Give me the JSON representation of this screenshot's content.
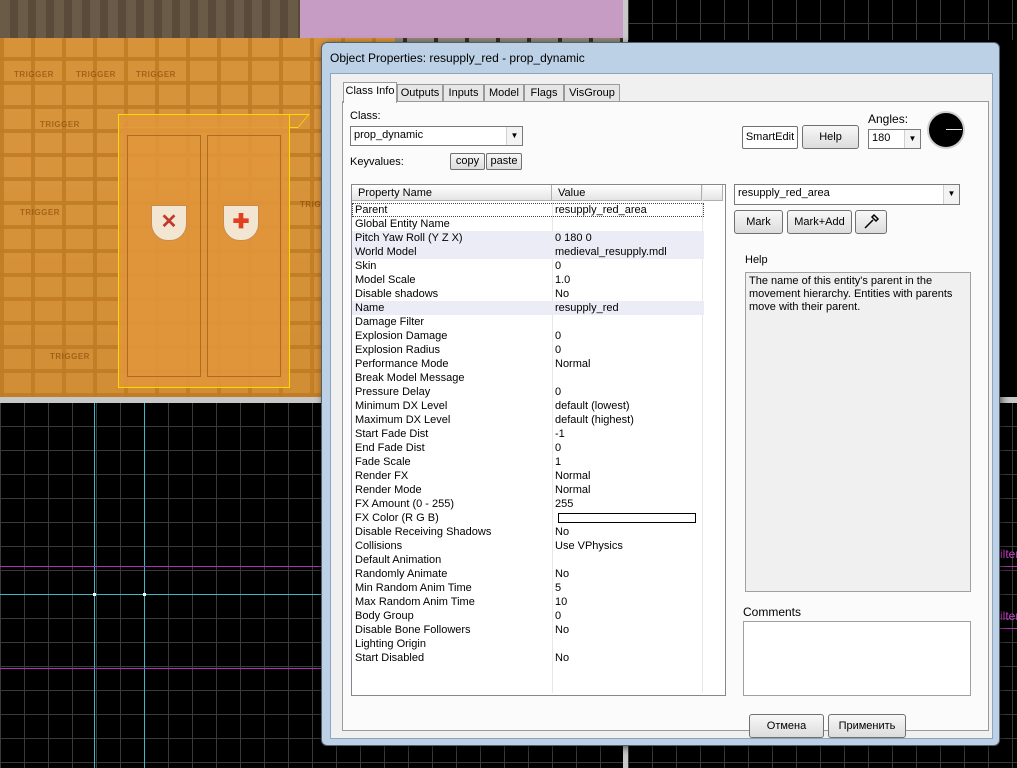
{
  "viewport": {
    "trigger_text": "TRIGGER",
    "overlay_label": "ilter"
  },
  "dialog": {
    "title": "Object Properties: resupply_red - prop_dynamic",
    "tabs": [
      {
        "label": "Class Info",
        "active": true
      },
      {
        "label": "Outputs"
      },
      {
        "label": "Inputs"
      },
      {
        "label": "Model"
      },
      {
        "label": "Flags"
      },
      {
        "label": "VisGroup"
      }
    ],
    "class_label": "Class:",
    "class_value": "prop_dynamic",
    "keyvalues_label": "Keyvalues:",
    "copy_label": "copy",
    "paste_label": "paste",
    "smartedit_label": "SmartEdit",
    "help_button_label": "Help",
    "angles_label": "Angles:",
    "angles_value": "180",
    "grid": {
      "col_property": "Property Name",
      "col_value": "Value",
      "rows": [
        {
          "name": "Parent",
          "value": "resupply_red_area"
        },
        {
          "name": "Global Entity Name",
          "value": ""
        },
        {
          "name": "Pitch Yaw Roll (Y Z X)",
          "value": "0 180 0"
        },
        {
          "name": "World Model",
          "value": "medieval_resupply.mdl"
        },
        {
          "name": "Skin",
          "value": "0"
        },
        {
          "name": "Model Scale",
          "value": "1.0"
        },
        {
          "name": "Disable shadows",
          "value": "No"
        },
        {
          "name": "Name",
          "value": "resupply_red"
        },
        {
          "name": "Damage Filter",
          "value": ""
        },
        {
          "name": "Explosion Damage",
          "value": "0"
        },
        {
          "name": "Explosion Radius",
          "value": "0"
        },
        {
          "name": "Performance Mode",
          "value": "Normal"
        },
        {
          "name": "Break Model Message",
          "value": ""
        },
        {
          "name": "Pressure Delay",
          "value": "0"
        },
        {
          "name": "Minimum DX Level",
          "value": "default (lowest)"
        },
        {
          "name": "Maximum DX Level",
          "value": "default (highest)"
        },
        {
          "name": "Start Fade Dist",
          "value": "-1"
        },
        {
          "name": "End Fade Dist",
          "value": "0"
        },
        {
          "name": "Fade Scale",
          "value": "1"
        },
        {
          "name": "Render FX",
          "value": "Normal"
        },
        {
          "name": "Render Mode",
          "value": "Normal"
        },
        {
          "name": "FX Amount (0 - 255)",
          "value": "255"
        },
        {
          "name": "FX Color (R G B)",
          "value": ""
        },
        {
          "name": "Disable Receiving Shadows",
          "value": "No"
        },
        {
          "name": "Collisions",
          "value": "Use VPhysics"
        },
        {
          "name": "Default Animation",
          "value": ""
        },
        {
          "name": "Randomly Animate",
          "value": "No"
        },
        {
          "name": "Min Random Anim Time",
          "value": "5"
        },
        {
          "name": "Max Random Anim Time",
          "value": "10"
        },
        {
          "name": "Body Group",
          "value": "0"
        },
        {
          "name": "Disable Bone Followers",
          "value": "No"
        },
        {
          "name": "Lighting Origin",
          "value": ""
        },
        {
          "name": "Start Disabled",
          "value": "No"
        }
      ]
    },
    "value_combo": "resupply_red_area",
    "mark_label": "Mark",
    "mark_add_label": "Mark+Add",
    "help_section_label": "Help",
    "help_text": "The name of this entity's parent in the movement hierarchy. Entities with parents move with their parent.",
    "comments_label": "Comments",
    "cancel_label": "Отмена",
    "apply_label": "Применить"
  },
  "colors": {
    "trigger_orange": "#eb9628",
    "selection_yellow": "#ffd800",
    "grid_cyan": "#3fb7c4",
    "grid_magenta": "#b030b0",
    "dialog_frame": "#bcd0e6"
  }
}
